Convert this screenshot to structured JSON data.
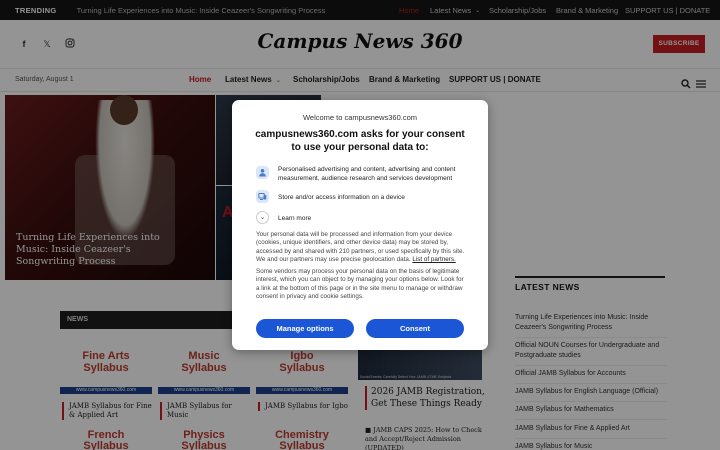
{
  "topbar": {
    "trending_label": "TRENDING",
    "trending_title": "Turning Life Experiences into Music: Inside Ceazeer's Songwriting Process",
    "nav": [
      {
        "label": "Home",
        "active": true
      },
      {
        "label": "Latest News",
        "has_dropdown": true
      },
      {
        "label": "Scholarship/Jobs"
      },
      {
        "label": "Brand & Marketing"
      },
      {
        "label": "SUPPORT US | DONATE"
      }
    ]
  },
  "header": {
    "logo": "Campus News 360",
    "subscribe_label": "SUBSCRIBE",
    "social_icons": [
      "facebook-icon",
      "x-twitter-icon",
      "instagram-icon"
    ]
  },
  "nav": {
    "date": "Saturday, August 1",
    "items": [
      {
        "label": "Home",
        "active": true
      },
      {
        "label": "Latest News",
        "has_dropdown": true
      },
      {
        "label": "Scholarship/Jobs"
      },
      {
        "label": "Brand & Marketing"
      },
      {
        "label": "SUPPORT US | DONATE"
      }
    ]
  },
  "hero": {
    "main_caption": "Turning Life Experiences into Music: Inside Ceazeer's Songwriting Process"
  },
  "news_section": {
    "label": "NEWS",
    "cards": [
      {
        "line1": "Fine Arts",
        "line2": "Syllabus",
        "url": "www.campusnews360.com",
        "caption": "JAMB Syllabus for Fine & Applied Art"
      },
      {
        "line1": "Music",
        "line2": "Syllabus",
        "url": "www.campusnews360.com",
        "caption": "JAMB Syllabus for Music"
      },
      {
        "line1": "Igbo",
        "line2": "Syllabus",
        "url": "www.campusnews360.com",
        "caption": "JAMB Syllabus for Igbo"
      }
    ],
    "cards_row2": [
      {
        "line1": "French",
        "line2": "Syllabus"
      },
      {
        "line1": "Physics",
        "line2": "Syllabus"
      },
      {
        "line1": "Chemistry",
        "line2": "Syllabus"
      }
    ],
    "image_caption": "Social Events: Carefully Select Your JAMB UTME Subjects",
    "article_1": "2026 JAMB Registration, Get These Things Ready",
    "article_2": "JAMB CAPS 2025: How to Check and Accept/Reject Admission (UPDATED)"
  },
  "sidebar": {
    "title": "LATEST NEWS",
    "items": [
      "Turning Life Experiences into Music: Inside Ceazeer's Songwriting Process",
      "Official NOUN Courses for Undergraduate and Postgraduate studies",
      "Official JAMB Syllabus for Accounts",
      "JAMB Syllabus for English Language (Official)",
      "JAMB Syllabus for Mathematics",
      "JAMB Syllabus for Fine & Applied Art",
      "JAMB Syllabus for Music"
    ]
  },
  "consent": {
    "welcome": "Welcome to campusnews360.com",
    "heading": "campusnews360.com asks for your consent to use your personal data to:",
    "purposes": [
      {
        "icon": "person-icon",
        "text": "Personalised advertising and content, advertising and content measurement, audience research and services development"
      },
      {
        "icon": "device-icon",
        "text": "Store and/or access information on a device"
      }
    ],
    "learn_more": "Learn more",
    "body_1": "Your personal data will be processed and information from your device (cookies, unique identifiers, and other device data) may be stored by, accessed by and shared with 210 partners, or used specifically by this site. We and our partners may use precise geolocation data.",
    "partners_link": "List of partners.",
    "body_2": "Some vendors may process your personal data on the basis of legitimate interest, which you can object to by managing your options below. Look for a link at the bottom of this page or in the site menu to manage or withdraw consent in privacy and cookie settings.",
    "manage_label": "Manage options",
    "consent_label": "Consent"
  },
  "colors": {
    "accent": "#c41d22",
    "consent_button": "#1a56d6",
    "topbar_bg": "#161616"
  }
}
